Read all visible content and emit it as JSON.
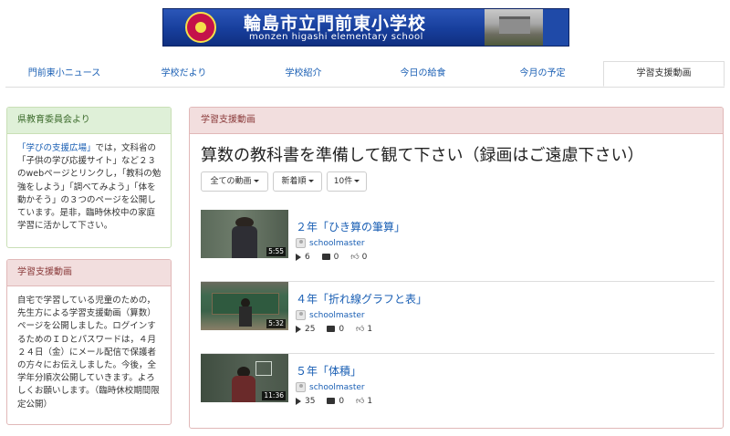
{
  "banner": {
    "title": "輪島市立門前東小学校",
    "subtitle": "monzen higashi elementary school"
  },
  "tabs": [
    {
      "label": "門前東小ニュース",
      "active": false
    },
    {
      "label": "学校だより",
      "active": false
    },
    {
      "label": "学校紹介",
      "active": false
    },
    {
      "label": "今日の給食",
      "active": false
    },
    {
      "label": "今月の予定",
      "active": false
    },
    {
      "label": "学習支援動画",
      "active": true
    }
  ],
  "sidebar": {
    "board": {
      "heading": "県教育委員会より",
      "link_text": "「学びの支援広場」",
      "body": "では，文科省の「子供の学び応援サイト」など２３のwebページとリンクし，「教科の勉強をしよう」「調べてみよう」「体を動かそう」の３つのページを公開しています。是非，臨時休校中の家庭学習に活かして下さい。"
    },
    "support": {
      "heading": "学習支援動画",
      "body": "自宅で学習している児童のための，先生方による学習支援動画（算数）ページを公開しました。ログインするためのＩＤとパスワードは，４月２４日（金）にメール配信で保護者の方々にお伝えしました。今後，全学年分順次公開していきます。よろしくお願いします。（臨時休校期間限定公開）"
    }
  },
  "main": {
    "heading": "学習支援動画",
    "title": "算数の教科書を準備して観て下さい（録画はご遠慮下さい）",
    "filters": {
      "category": "全ての動画",
      "sort": "新着順",
      "count": "10件"
    },
    "videos": [
      {
        "title": "２年「ひき算の筆算」",
        "author": "schoolmaster",
        "duration": "5:55",
        "views": "6",
        "comments": "0",
        "likes": "0"
      },
      {
        "title": "４年「折れ線グラフと表」",
        "author": "schoolmaster",
        "duration": "5:32",
        "views": "25",
        "comments": "0",
        "likes": "1"
      },
      {
        "title": "５年「体積」",
        "author": "schoolmaster",
        "duration": "11:36",
        "views": "35",
        "comments": "0",
        "likes": "1"
      }
    ]
  },
  "icons": {
    "views": "play-icon",
    "comments": "comment-icon",
    "likes": "thumbs-up-icon"
  },
  "colors": {
    "link": "#1a5fb4",
    "green_panel": "#dff0d8",
    "red_panel": "#f2dede",
    "banner": "#1f4aa8"
  }
}
